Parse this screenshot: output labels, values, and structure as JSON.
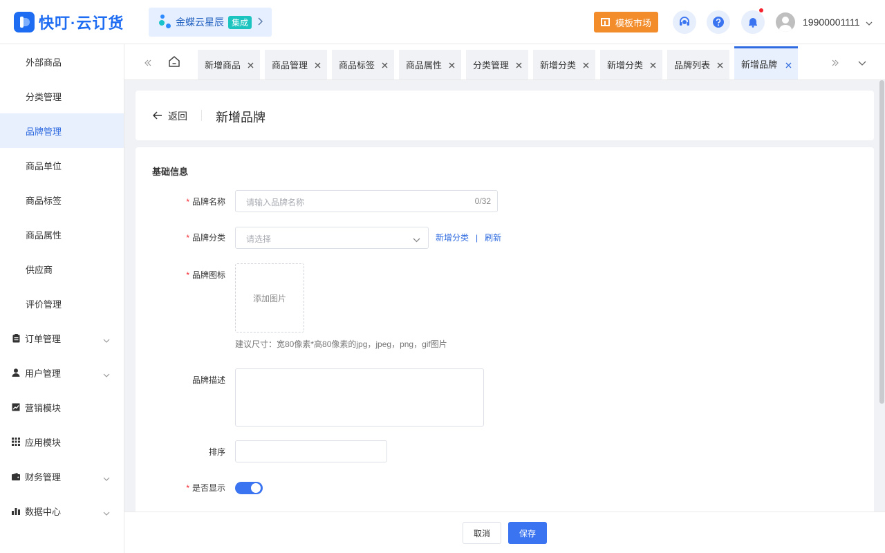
{
  "header": {
    "logo_text": "快叮·云订货",
    "kingdee": {
      "name": "金蝶云星辰",
      "tag": "集成"
    },
    "template_market": "模板市场",
    "user_phone": "19900001111"
  },
  "sidebar": {
    "sub_items": [
      {
        "label": "外部商品",
        "active": false
      },
      {
        "label": "分类管理",
        "active": false
      },
      {
        "label": "品牌管理",
        "active": true
      },
      {
        "label": "商品单位",
        "active": false
      },
      {
        "label": "商品标签",
        "active": false
      },
      {
        "label": "商品属性",
        "active": false
      },
      {
        "label": "供应商",
        "active": false
      },
      {
        "label": "评价管理",
        "active": false
      }
    ],
    "groups": [
      {
        "label": "订单管理",
        "icon": "clipboard-icon",
        "expandable": true
      },
      {
        "label": "用户管理",
        "icon": "user-icon",
        "expandable": true
      },
      {
        "label": "营销模块",
        "icon": "trend-chart-icon",
        "expandable": false
      },
      {
        "label": "应用模块",
        "icon": "grid-icon",
        "expandable": false
      },
      {
        "label": "财务管理",
        "icon": "wallet-icon",
        "expandable": true
      },
      {
        "label": "数据中心",
        "icon": "bar-chart-icon",
        "expandable": true
      }
    ]
  },
  "tabs": [
    {
      "label": "新增商品",
      "active": false
    },
    {
      "label": "商品管理",
      "active": false
    },
    {
      "label": "商品标签",
      "active": false
    },
    {
      "label": "商品属性",
      "active": false
    },
    {
      "label": "分类管理",
      "active": false
    },
    {
      "label": "新增分类",
      "active": false
    },
    {
      "label": "新增分类",
      "active": false
    },
    {
      "label": "品牌列表",
      "active": false
    },
    {
      "label": "新增品牌",
      "active": true
    }
  ],
  "page": {
    "back_label": "返回",
    "title": "新增品牌"
  },
  "form": {
    "section_title": "基础信息",
    "brand_name": {
      "label": "品牌名称",
      "placeholder": "请输入品牌名称",
      "value": "",
      "counter": "0/32",
      "required": true
    },
    "brand_category": {
      "label": "品牌分类",
      "placeholder": "请选择",
      "required": true,
      "add_link": "新增分类",
      "separator": "|",
      "refresh_link": "刷新"
    },
    "brand_icon": {
      "label": "品牌图标",
      "upload_label": "添加图片",
      "hint": "建议尺寸：宽80像素*高80像素的jpg，jpeg，png，gif图片",
      "required": true
    },
    "brand_desc": {
      "label": "品牌描述",
      "value": ""
    },
    "sort": {
      "label": "排序",
      "value": ""
    },
    "show": {
      "label": "是否显示",
      "enabled": true,
      "required": true
    }
  },
  "footer": {
    "cancel_label": "取消",
    "save_label": "保存"
  },
  "colors": {
    "brand": "#1e6cf2",
    "primary": "#3a74f0",
    "template_button": "#f38d2c",
    "required": "#f5222d",
    "active_bg": "#e9f0fd"
  }
}
